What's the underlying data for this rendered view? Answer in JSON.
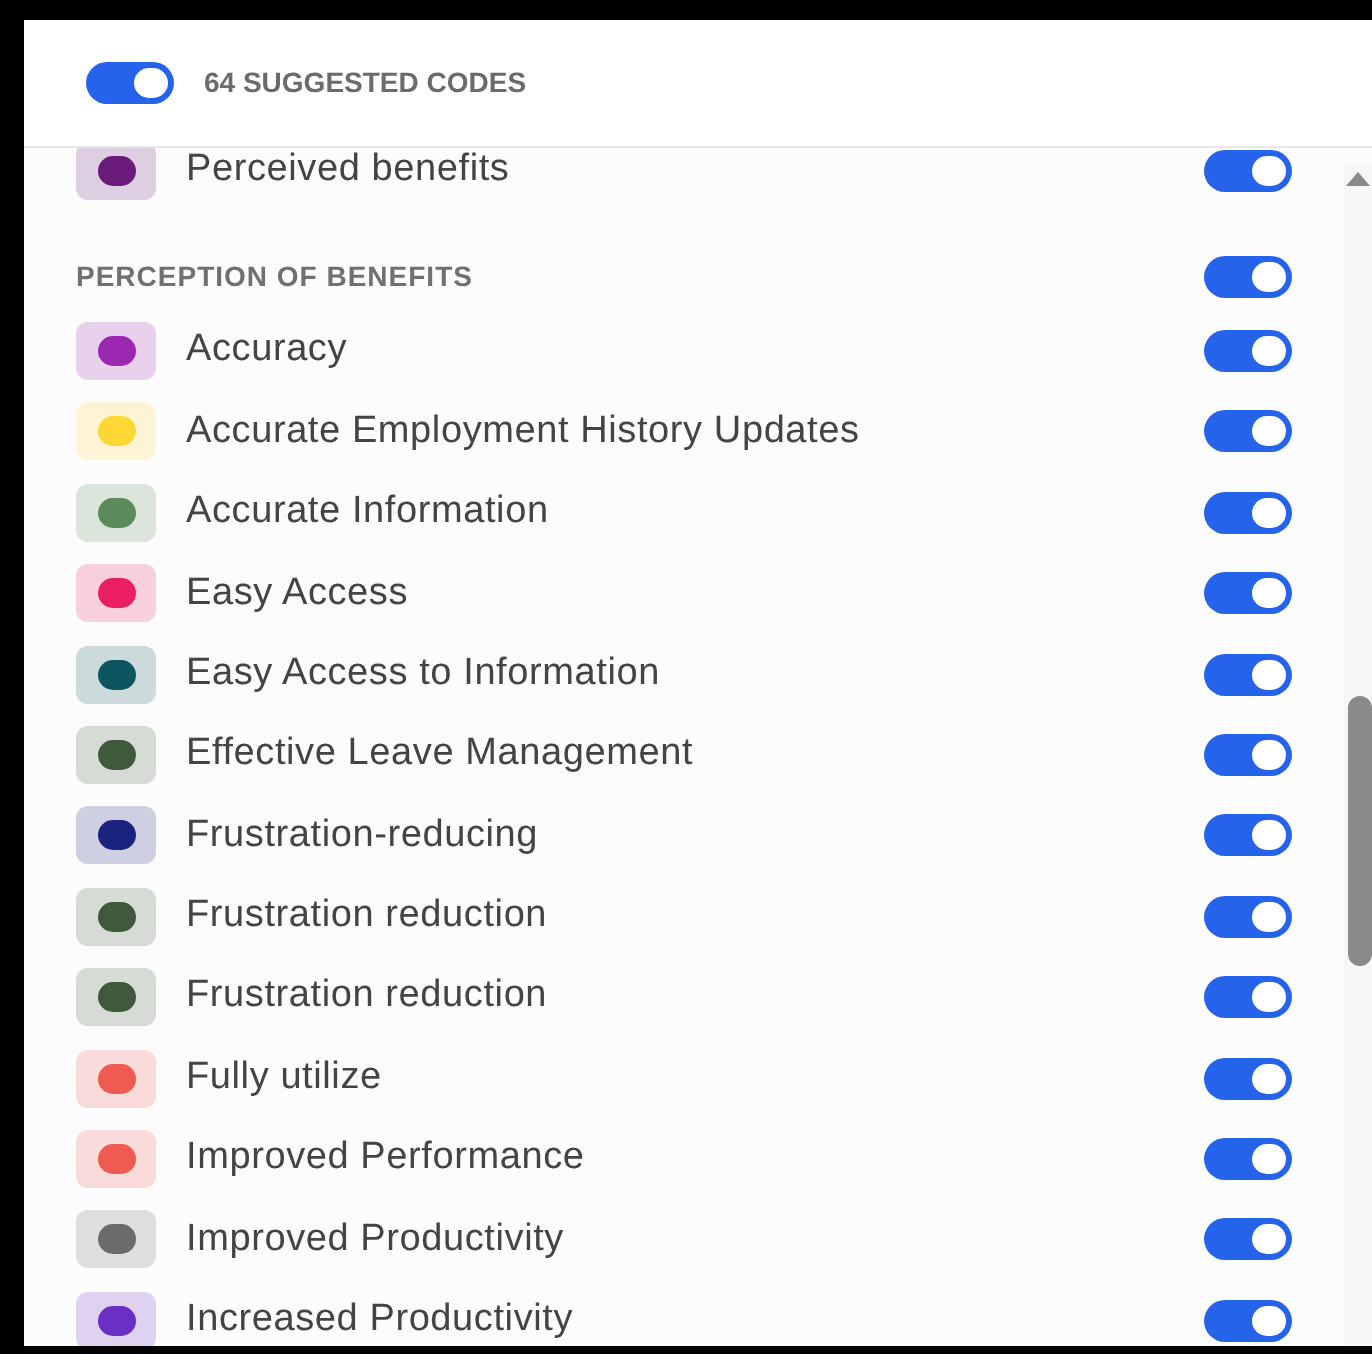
{
  "header": {
    "toggle_on": true,
    "label": "64 SUGGESTED CODES"
  },
  "items": [
    {
      "kind": "code",
      "label": "Perceived benefits",
      "color": "#6a1b7a",
      "on": true
    },
    {
      "kind": "heading",
      "label": "PERCEPTION OF BENEFITS",
      "on": true
    },
    {
      "kind": "code",
      "label": "Accuracy",
      "color": "#9c27b0",
      "on": true
    },
    {
      "kind": "code",
      "label": "Accurate Employment History Updates",
      "color": "#fdd835",
      "on": true
    },
    {
      "kind": "code",
      "label": "Accurate Information",
      "color": "#5b8a5b",
      "on": true
    },
    {
      "kind": "code",
      "label": "Easy Access",
      "color": "#e91e63",
      "on": true
    },
    {
      "kind": "code",
      "label": "Easy Access to Information",
      "color": "#0d5560",
      "on": true
    },
    {
      "kind": "code",
      "label": "Effective Leave Management",
      "color": "#3f5a3a",
      "on": true
    },
    {
      "kind": "code",
      "label": "Frustration-reducing",
      "color": "#1a237e",
      "on": true
    },
    {
      "kind": "code",
      "label": "Frustration reduction",
      "color": "#3f5a3a",
      "on": true
    },
    {
      "kind": "code",
      "label": "Frustration reduction",
      "color": "#3f5a3a",
      "on": true
    },
    {
      "kind": "code",
      "label": "Fully utilize",
      "color": "#ef5b50",
      "on": true
    },
    {
      "kind": "code",
      "label": "Improved Performance",
      "color": "#ef5b50",
      "on": true
    },
    {
      "kind": "code",
      "label": "Improved Productivity",
      "color": "#6b6b6b",
      "on": true
    },
    {
      "kind": "code",
      "label": "Increased Productivity",
      "color": "#6a2fc4",
      "on": true
    }
  ]
}
